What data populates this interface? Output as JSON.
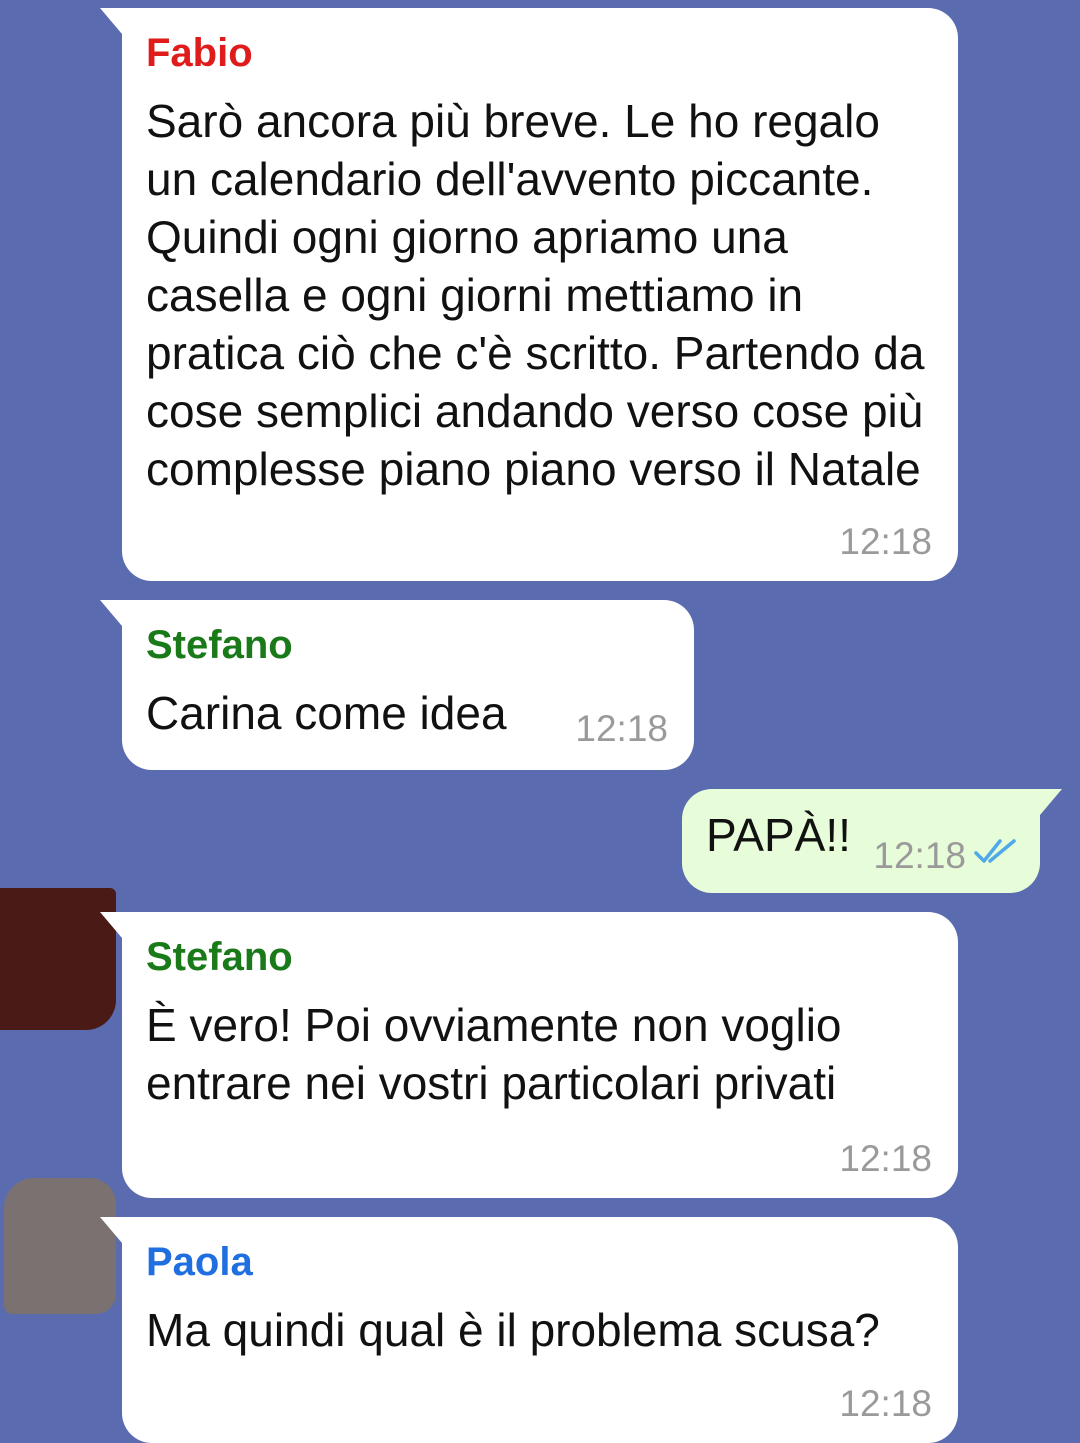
{
  "messages": [
    {
      "sender": "Fabio",
      "sender_color": "#e01b1b",
      "text": "Sarò ancora più breve. Le ho regalo un calendario dell'avvento piccante. Quindi ogni giorno apriamo una casella e ogni giorni mettiamo in pratica ciò che c'è scritto. Partendo da cose semplici andando verso cose più complesse piano piano verso il Natale",
      "time": "12:18"
    },
    {
      "sender": "Stefano",
      "sender_color": "#1a7a1a",
      "text": "Carina come idea",
      "time": "12:18"
    },
    {
      "text": "PAPÀ!!",
      "time": "12:18",
      "status_icon": "double-check-icon",
      "status_color": "#4fa8e8"
    },
    {
      "sender": "Stefano",
      "sender_color": "#1a7a1a",
      "text": "È vero! Poi ovviamente non voglio entrare nei vostri particolari privati",
      "time": "12:18"
    },
    {
      "sender": "Paola",
      "sender_color": "#1f6fe0",
      "text": "Ma quindi qual è il problema scusa?",
      "time": "12:18"
    }
  ]
}
